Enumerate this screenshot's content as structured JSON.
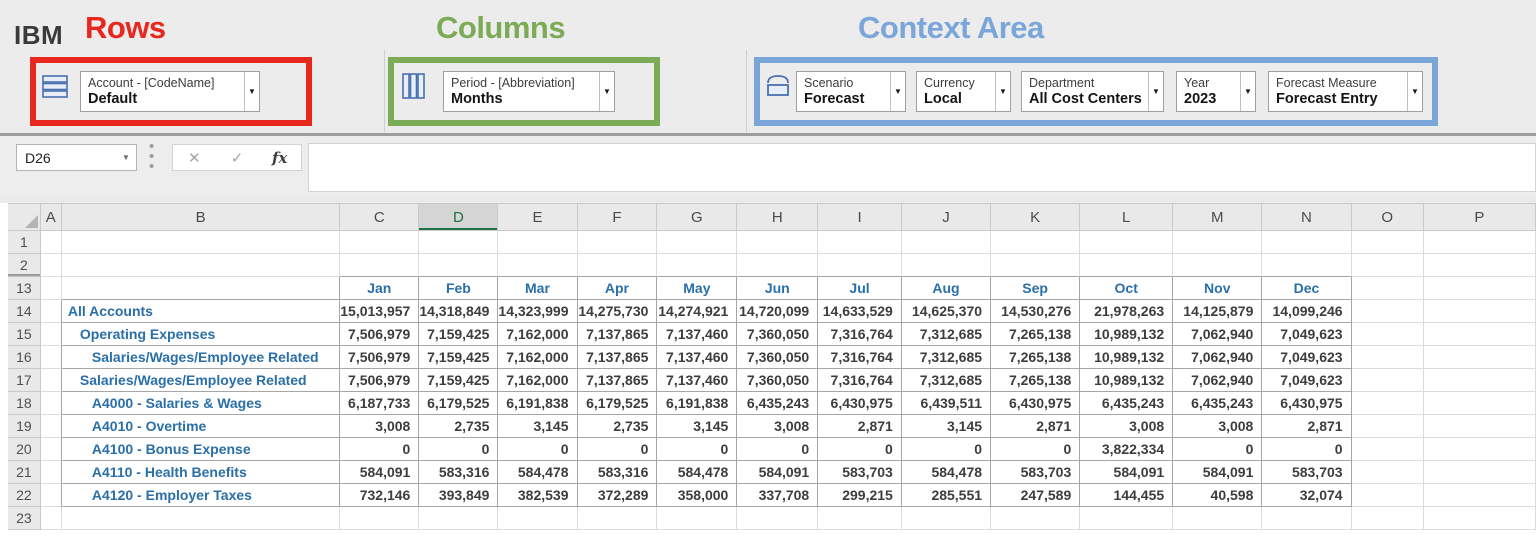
{
  "branding": {
    "logo": "IBM"
  },
  "annotations": {
    "rows_label": "Rows",
    "columns_label": "Columns",
    "context_label": "Context Area",
    "rows_color": "#e8271e",
    "columns_color": "#7cab55",
    "context_color": "#7ba6d9"
  },
  "toolbar": {
    "rows_group": {
      "dropdown": {
        "label": "Account - [CodeName]",
        "value": "Default"
      }
    },
    "columns_group": {
      "dropdown": {
        "label": "Period - [Abbreviation]",
        "value": "Months"
      }
    },
    "context_group": {
      "dropdowns": [
        {
          "label": "Scenario",
          "value": "Forecast"
        },
        {
          "label": "Currency",
          "value": "Local"
        },
        {
          "label": "Department",
          "value": "All Cost Centers"
        },
        {
          "label": "Year",
          "value": "2023"
        },
        {
          "label": "Forecast Measure",
          "value": "Forecast Entry"
        }
      ]
    }
  },
  "formula_bar": {
    "name_box_value": "D26",
    "dropdown_arrow_icon": "▼",
    "cancel_icon": "✕",
    "enter_icon": "✓",
    "function_icon": "fx",
    "formula_value": ""
  },
  "grid": {
    "selected_column": "D",
    "column_letters": [
      "A",
      "B",
      "C",
      "D",
      "E",
      "F",
      "G",
      "H",
      "I",
      "J",
      "K",
      "L",
      "M",
      "N",
      "O",
      "P"
    ],
    "accent_selected_header": "#217346",
    "label_color": "#2a6fa8",
    "rows": [
      {
        "num": 1
      },
      {
        "num": 2
      },
      {
        "num": 13,
        "months": [
          "Jan",
          "Feb",
          "Mar",
          "Apr",
          "May",
          "Jun",
          "Jul",
          "Aug",
          "Sep",
          "Oct",
          "Nov",
          "Dec"
        ]
      },
      {
        "num": 14,
        "label": "All Accounts",
        "indent": 0,
        "values": [
          "15,013,957",
          "14,318,849",
          "14,323,999",
          "14,275,730",
          "14,274,921",
          "14,720,099",
          "14,633,529",
          "14,625,370",
          "14,530,276",
          "21,978,263",
          "14,125,879",
          "14,099,246"
        ]
      },
      {
        "num": 15,
        "label": "Operating Expenses",
        "indent": 1,
        "values": [
          "7,506,979",
          "7,159,425",
          "7,162,000",
          "7,137,865",
          "7,137,460",
          "7,360,050",
          "7,316,764",
          "7,312,685",
          "7,265,138",
          "10,989,132",
          "7,062,940",
          "7,049,623"
        ]
      },
      {
        "num": 16,
        "label": "Salaries/Wages/Employee Related",
        "indent": 2,
        "values": [
          "7,506,979",
          "7,159,425",
          "7,162,000",
          "7,137,865",
          "7,137,460",
          "7,360,050",
          "7,316,764",
          "7,312,685",
          "7,265,138",
          "10,989,132",
          "7,062,940",
          "7,049,623"
        ]
      },
      {
        "num": 17,
        "label": "Salaries/Wages/Employee Related",
        "indent": 1,
        "values": [
          "7,506,979",
          "7,159,425",
          "7,162,000",
          "7,137,865",
          "7,137,460",
          "7,360,050",
          "7,316,764",
          "7,312,685",
          "7,265,138",
          "10,989,132",
          "7,062,940",
          "7,049,623"
        ]
      },
      {
        "num": 18,
        "label": "A4000 - Salaries & Wages",
        "indent": 2,
        "values": [
          "6,187,733",
          "6,179,525",
          "6,191,838",
          "6,179,525",
          "6,191,838",
          "6,435,243",
          "6,430,975",
          "6,439,511",
          "6,430,975",
          "6,435,243",
          "6,435,243",
          "6,430,975"
        ]
      },
      {
        "num": 19,
        "label": "A4010 - Overtime",
        "indent": 2,
        "values": [
          "3,008",
          "2,735",
          "3,145",
          "2,735",
          "3,145",
          "3,008",
          "2,871",
          "3,145",
          "2,871",
          "3,008",
          "3,008",
          "2,871"
        ]
      },
      {
        "num": 20,
        "label": "A4100 - Bonus Expense",
        "indent": 2,
        "values": [
          "0",
          "0",
          "0",
          "0",
          "0",
          "0",
          "0",
          "0",
          "0",
          "3,822,334",
          "0",
          "0"
        ]
      },
      {
        "num": 21,
        "label": "A4110 - Health Benefits",
        "indent": 2,
        "values": [
          "584,091",
          "583,316",
          "584,478",
          "583,316",
          "584,478",
          "584,091",
          "583,703",
          "584,478",
          "583,703",
          "584,091",
          "584,091",
          "583,703"
        ]
      },
      {
        "num": 22,
        "label": "A4120 - Employer Taxes",
        "indent": 2,
        "values": [
          "732,146",
          "393,849",
          "382,539",
          "372,289",
          "358,000",
          "337,708",
          "299,215",
          "285,551",
          "247,589",
          "144,455",
          "40,598",
          "32,074"
        ]
      },
      {
        "num": 23
      }
    ]
  }
}
